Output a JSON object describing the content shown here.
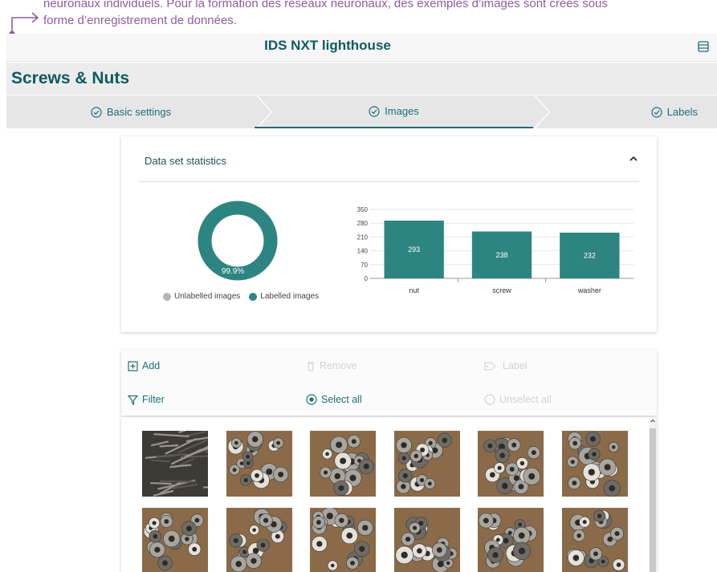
{
  "annotation": {
    "line1": "neuronaux individuels. Pour la formation des réseaux neuronaux, des exemples d’images sont créés sous",
    "line2": "forme d’enregistrement de données."
  },
  "app": {
    "title": "IDS NXT lighthouse",
    "menu_icon": "list-icon"
  },
  "project": {
    "title": "Screws & Nuts"
  },
  "steps": [
    {
      "label": "Basic settings",
      "icon": "check-circle-icon"
    },
    {
      "label": "Images",
      "icon": "check-circle-icon",
      "active": true
    },
    {
      "label": "Labels",
      "icon": "check-circle-icon"
    }
  ],
  "stats": {
    "heading": "Data set statistics",
    "donut": {
      "labelled_fraction": 0.999,
      "center_label": "99.9%"
    },
    "legend": {
      "unlabelled": "Unlabelled images",
      "labelled": "Labelled images"
    }
  },
  "chart_data": {
    "type": "bar",
    "categories": [
      "nut",
      "screw",
      "washer"
    ],
    "values": [
      293,
      238,
      232
    ],
    "y_ticks": [
      "350",
      "280",
      "210",
      "140",
      "70",
      "0"
    ],
    "ylim": [
      0,
      350
    ],
    "colors": {
      "bar": "#2d8582",
      "labelled": "#2d8582",
      "unlabelled": "#b5b5b5"
    }
  },
  "toolbar": {
    "add": "Add",
    "remove": "Remove",
    "label": "Label",
    "filter": "Filter",
    "select_all": "Select all",
    "unselect_all": "Unselect all"
  },
  "gallery": {
    "thumbnails": [
      {
        "kind": "screws"
      },
      {
        "kind": "washers"
      },
      {
        "kind": "washers"
      },
      {
        "kind": "washers"
      },
      {
        "kind": "washers"
      },
      {
        "kind": "washers"
      },
      {
        "kind": "washers"
      },
      {
        "kind": "washers"
      },
      {
        "kind": "washers"
      },
      {
        "kind": "washers"
      },
      {
        "kind": "washers"
      },
      {
        "kind": "washers"
      }
    ]
  }
}
